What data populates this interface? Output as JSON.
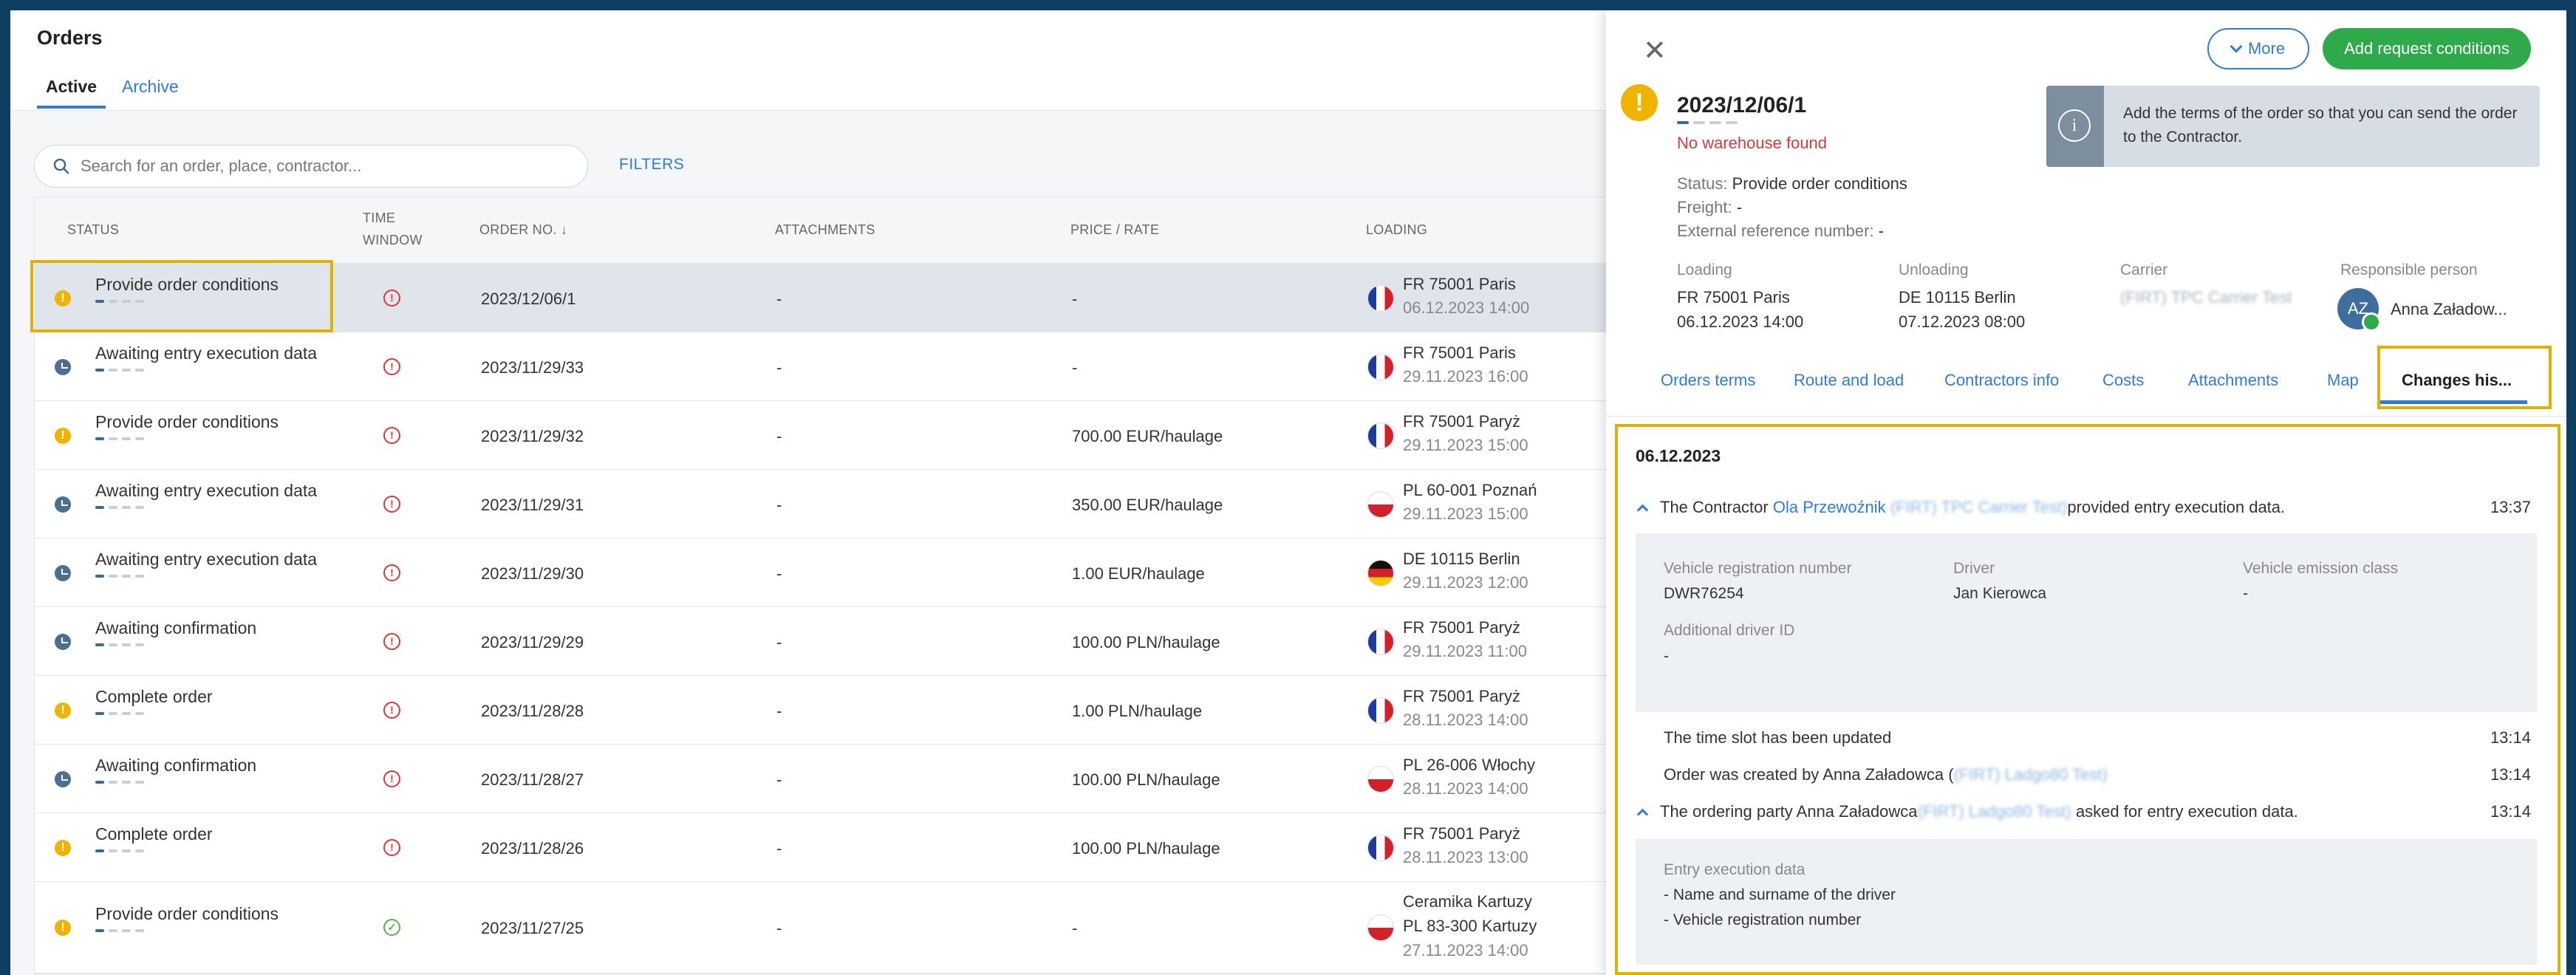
{
  "header": {
    "title": "Orders",
    "tabs": [
      "Active",
      "Archive"
    ]
  },
  "search": {
    "placeholder": "Search for an order, place, contractor..."
  },
  "filters_label": "FILTERS",
  "columns": {
    "status": "STATUS",
    "time_window_1": "TIME",
    "time_window_2": "WINDOW",
    "order_no": "ORDER NO. ↓",
    "attachments": "ATTACHMENTS",
    "price": "PRICE / RATE",
    "loading": "LOADING"
  },
  "rows": [
    {
      "icon": "warn",
      "status": "Provide order conditions",
      "tw": "alert",
      "order": "2023/12/06/1",
      "att": "-",
      "price": "-",
      "flag": "fr",
      "l1": "FR 75001 Paris",
      "l2": "06.12.2023 14:00"
    },
    {
      "icon": "clock",
      "status": "Awaiting entry execution data",
      "tw": "alert",
      "order": "2023/11/29/33",
      "att": "-",
      "price": "-",
      "flag": "fr",
      "l1": "FR 75001 Paris",
      "l2": "29.11.2023 16:00"
    },
    {
      "icon": "warn",
      "status": "Provide order conditions",
      "tw": "alert",
      "order": "2023/11/29/32",
      "att": "-",
      "price": "700.00 EUR/haulage",
      "flag": "fr",
      "l1": "FR 75001 Paryż",
      "l2": "29.11.2023 15:00"
    },
    {
      "icon": "clock",
      "status": "Awaiting entry execution data",
      "tw": "alert",
      "order": "2023/11/29/31",
      "att": "-",
      "price": "350.00 EUR/haulage",
      "flag": "pl",
      "l1": "PL 60-001 Poznań",
      "l2": "29.11.2023 15:00"
    },
    {
      "icon": "clock",
      "status": "Awaiting entry execution data",
      "tw": "alert",
      "order": "2023/11/29/30",
      "att": "-",
      "price": "1.00 EUR/haulage",
      "flag": "de",
      "l1": "DE 10115 Berlin",
      "l2": "29.11.2023 12:00"
    },
    {
      "icon": "clock",
      "status": "Awaiting confirmation",
      "tw": "alert",
      "order": "2023/11/29/29",
      "att": "-",
      "price": "100.00 PLN/haulage",
      "flag": "fr",
      "l1": "FR 75001 Paryż",
      "l2": "29.11.2023 11:00"
    },
    {
      "icon": "warn",
      "status": "Complete order",
      "tw": "alert",
      "order": "2023/11/28/28",
      "att": "-",
      "price": "1.00 PLN/haulage",
      "flag": "fr",
      "l1": "FR 75001 Paryż",
      "l2": "28.11.2023 14:00"
    },
    {
      "icon": "clock",
      "status": "Awaiting confirmation",
      "tw": "alert",
      "order": "2023/11/28/27",
      "att": "-",
      "price": "100.00 PLN/haulage",
      "flag": "pl",
      "l1": "PL 26-006 Włochy",
      "l2": "28.11.2023 14:00"
    },
    {
      "icon": "warn",
      "status": "Complete order",
      "tw": "alert",
      "order": "2023/11/28/26",
      "att": "-",
      "price": "100.00 PLN/haulage",
      "flag": "fr",
      "l1": "FR 75001 Paryż",
      "l2": "28.11.2023 13:00"
    },
    {
      "icon": "warn",
      "status": "Provide order conditions",
      "tw": "ok",
      "order": "2023/11/27/25",
      "att": "-",
      "price": "-",
      "flag": "pl",
      "l0": "Ceramika Kartuzy",
      "l1": "PL 83-300 Kartuzy",
      "l2": "27.11.2023 14:00"
    }
  ],
  "panel": {
    "more_label": "More",
    "add_label": "Add request conditions",
    "order_no": "2023/12/06/1",
    "warning": "No warehouse found",
    "info": "Add the terms of the order so that you can send the order to the Contractor.",
    "status_key": "Status:",
    "status_val": "Provide order conditions",
    "freight_key": "Freight:",
    "freight_val": "-",
    "extref_key": "External reference number:",
    "extref_val": "-",
    "loading_label": "Loading",
    "loading_place": "FR 75001 Paris",
    "loading_date": "06.12.2023 14:00",
    "unloading_label": "Unloading",
    "unloading_place": "DE 10115 Berlin",
    "unloading_date": "07.12.2023 08:00",
    "carrier_label": "Carrier",
    "carrier_val": "(FIRT) TPC Carrier Test",
    "resp_label": "Responsible person",
    "resp_initials": "AZ",
    "resp_name": "Anna Załadow...",
    "tabs": [
      "Orders terms",
      "Route and load",
      "Contractors info",
      "Costs",
      "Attachments",
      "Map",
      "Changes his..."
    ]
  },
  "history": {
    "date": "06.12.2023",
    "e1_pre": "The Contractor ",
    "e1_link": "Ola Przewoźnik",
    "e1_blur": "(FIRT) TPC Carrier Test)",
    "e1_post": "provided entry execution data.",
    "e1_time": "13:37",
    "vrn_label": "Vehicle registration number",
    "vrn_val": "DWR76254",
    "driver_label": "Driver",
    "driver_val": "Jan Kierowca",
    "emission_label": "Vehicle emission class",
    "emission_val": "-",
    "adid_label": "Additional driver ID",
    "adid_val": "-",
    "e2": "The time slot has been updated",
    "e2_time": "13:14",
    "e3_pre": "Order was created by Anna Załadowca (",
    "e3_blur": "(FIRT) Ladgo80 Test)",
    "e3_time": "13:14",
    "e4_pre": "The ordering party Anna Załadowca",
    "e4_blur": "(FIRT) Ladgo80 Test)",
    "e4_post": " asked for entry execution data.",
    "e4_time": "13:14",
    "eed_label": "Entry execution data",
    "eed_1": "- Name and surname of the driver",
    "eed_2": "- Vehicle registration number"
  }
}
